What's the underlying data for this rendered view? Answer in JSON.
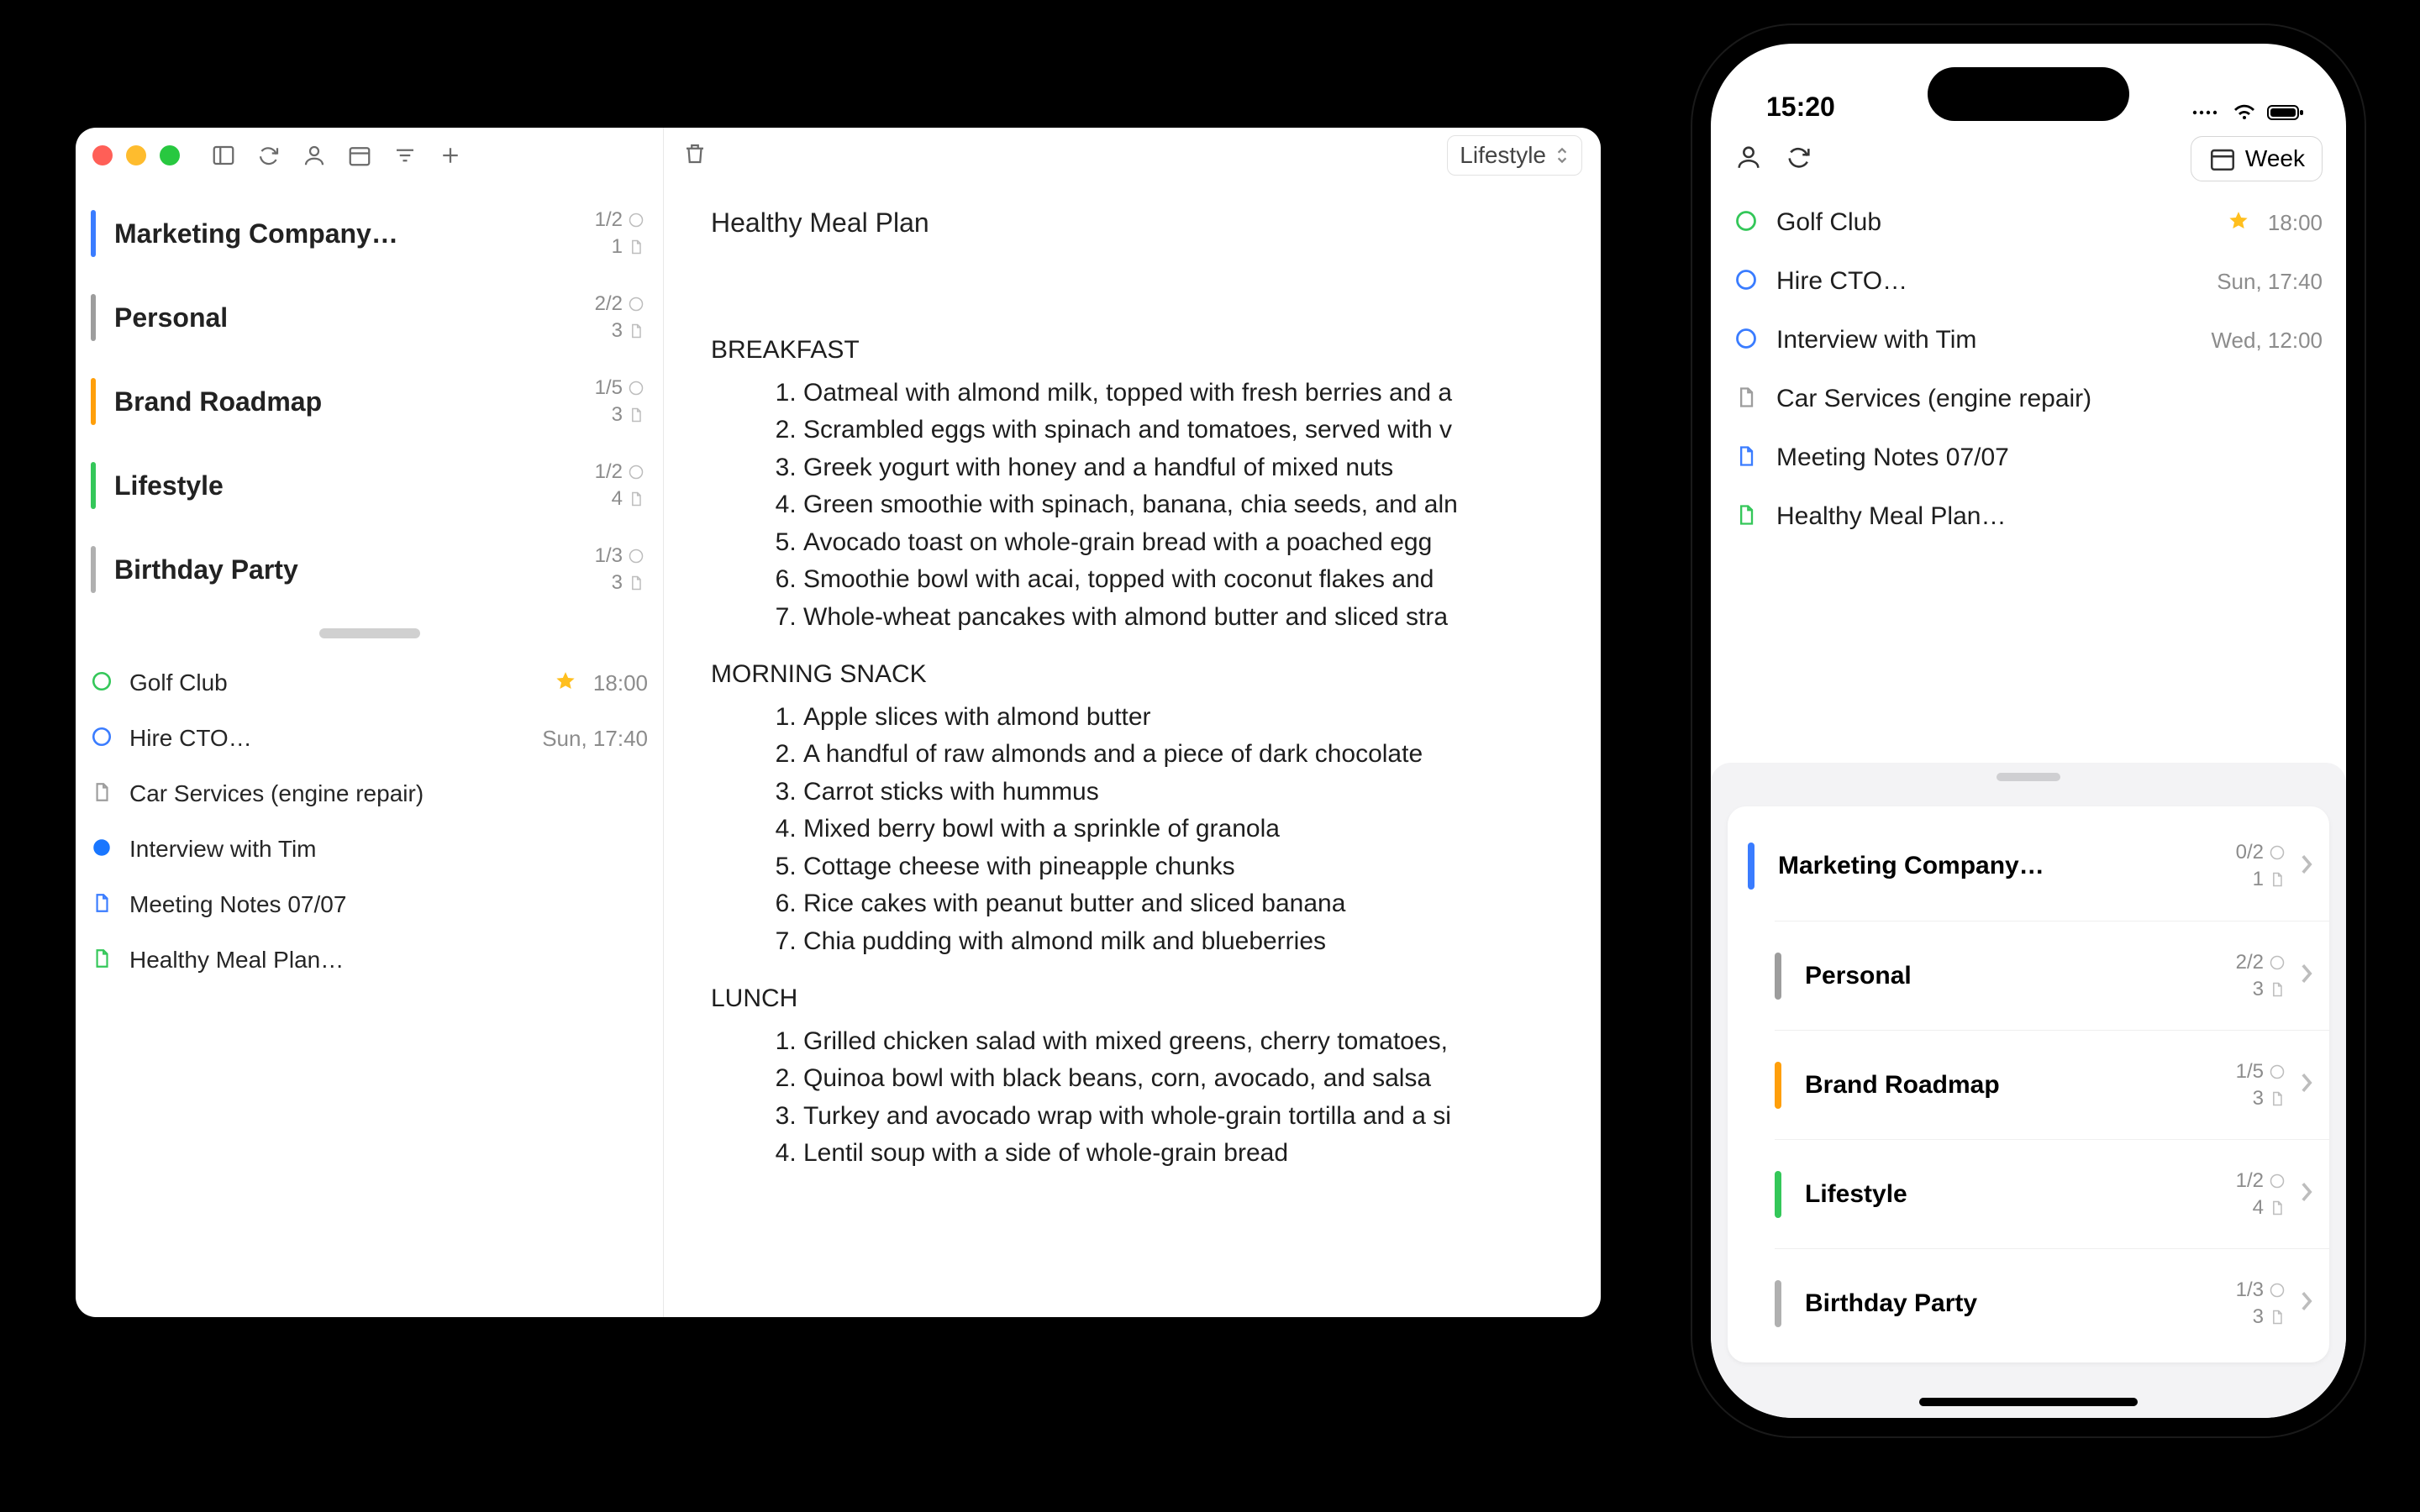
{
  "mac": {
    "toolbar": {
      "tag_select": "Lifestyle"
    },
    "lists": [
      {
        "name": "Marketing Company…",
        "color": "#3a7cff",
        "tasks": "1/2",
        "notes": "1"
      },
      {
        "name": "Personal",
        "color": "#9d9d9d",
        "tasks": "2/2",
        "notes": "3"
      },
      {
        "name": "Brand Roadmap",
        "color": "#ff9f0a",
        "tasks": "1/5",
        "notes": "3"
      },
      {
        "name": "Lifestyle",
        "color": "#34c759",
        "tasks": "1/2",
        "notes": "4"
      },
      {
        "name": "Birthday Party",
        "color": "#b0b0b0",
        "tasks": "1/3",
        "notes": "3"
      }
    ],
    "tasks": [
      {
        "icon": "circle",
        "color": "#34c759",
        "name": "Golf Club",
        "starred": true,
        "time": "18:00"
      },
      {
        "icon": "circle",
        "color": "#3a7cff",
        "name": "Hire CTO…",
        "starred": false,
        "time": "Sun, 17:40"
      },
      {
        "icon": "doc",
        "color": "#9d9d9d",
        "name": "Car Services (engine repair)",
        "starred": false,
        "time": ""
      },
      {
        "icon": "dot",
        "color": "#1976ff",
        "name": "Interview with Tim",
        "starred": false,
        "time": ""
      },
      {
        "icon": "doc",
        "color": "#3a7cff",
        "name": "Meeting Notes 07/07",
        "starred": false,
        "time": ""
      },
      {
        "icon": "doc",
        "color": "#34c759",
        "name": "Healthy Meal Plan…",
        "starred": false,
        "time": ""
      }
    ],
    "note": {
      "title": "Healthy Meal Plan",
      "sections": [
        {
          "heading": "BREAKFAST",
          "items": [
            "Oatmeal with almond milk, topped with fresh berries and a",
            "Scrambled eggs with spinach and tomatoes, served with v",
            "Greek yogurt with honey and a handful of mixed nuts",
            "Green smoothie with spinach, banana, chia seeds, and aln",
            "Avocado toast on whole-grain bread with a poached egg",
            "Smoothie bowl with acai, topped with coconut flakes and",
            "Whole-wheat pancakes with almond butter and sliced stra"
          ]
        },
        {
          "heading": "MORNING SNACK",
          "items": [
            "Apple slices with almond butter",
            "A handful of raw almonds and a piece of dark chocolate",
            "Carrot sticks with hummus",
            "Mixed berry bowl with a sprinkle of granola",
            "Cottage cheese with pineapple chunks",
            "Rice cakes with peanut butter and sliced banana",
            "Chia pudding with almond milk and blueberries"
          ]
        },
        {
          "heading": "LUNCH",
          "items": [
            "Grilled chicken salad with mixed greens, cherry tomatoes,",
            "Quinoa bowl with black beans, corn, avocado, and salsa",
            "Turkey and avocado wrap with whole-grain tortilla and a si",
            "Lentil soup with a side of whole-grain bread"
          ]
        }
      ]
    }
  },
  "phone": {
    "status_time": "15:20",
    "week_label": "Week",
    "tasks": [
      {
        "icon": "circle",
        "color": "#34c759",
        "name": "Golf Club",
        "starred": true,
        "time": "18:00"
      },
      {
        "icon": "circle",
        "color": "#3a7cff",
        "name": "Hire CTO…",
        "starred": false,
        "time": "Sun, 17:40"
      },
      {
        "icon": "circle",
        "color": "#3a7cff",
        "name": "Interview with Tim",
        "starred": false,
        "time": "Wed, 12:00"
      },
      {
        "icon": "doc",
        "color": "#9d9d9d",
        "name": "Car Services (engine repair)",
        "starred": false,
        "time": ""
      },
      {
        "icon": "doc",
        "color": "#3a7cff",
        "name": "Meeting Notes 07/07",
        "starred": false,
        "time": ""
      },
      {
        "icon": "doc",
        "color": "#34c759",
        "name": "Healthy Meal Plan…",
        "starred": false,
        "time": ""
      }
    ],
    "lists": [
      {
        "name": "Marketing Company…",
        "color": "#3a7cff",
        "tasks": "0/2",
        "notes": "1"
      },
      {
        "name": "Personal",
        "color": "#9d9d9d",
        "tasks": "2/2",
        "notes": "3"
      },
      {
        "name": "Brand Roadmap",
        "color": "#ff9f0a",
        "tasks": "1/5",
        "notes": "3"
      },
      {
        "name": "Lifestyle",
        "color": "#34c759",
        "tasks": "1/2",
        "notes": "4"
      },
      {
        "name": "Birthday Party",
        "color": "#b0b0b0",
        "tasks": "1/3",
        "notes": "3"
      }
    ]
  }
}
